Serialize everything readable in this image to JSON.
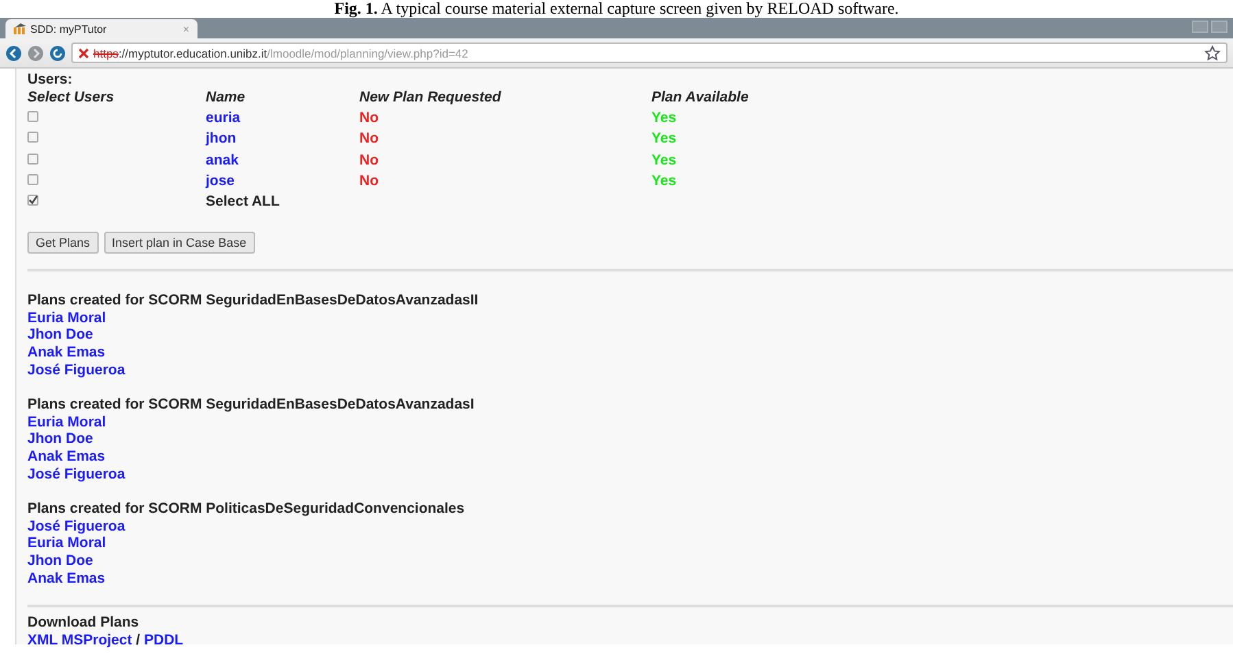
{
  "caption": "**Fig. 1.** A typical course material external capture screen given by RELOAD software.",
  "browser": {
    "tab_title": "SDD: myPTutor",
    "tab_close": "×",
    "certificate_error": true,
    "url_scheme": "https",
    "url_host": "://myptutor.education.unibz.it",
    "url_path": "/lmoodle/mod/planning/view.php?id=42"
  },
  "users": {
    "heading": "Users:",
    "columns": [
      "Select Users",
      "Name",
      "New Plan Requested",
      "Plan Available"
    ],
    "rows": [
      {
        "checked": false,
        "name": "euria",
        "new_plan_requested": "No",
        "plan_available": "Yes"
      },
      {
        "checked": false,
        "name": "jhon",
        "new_plan_requested": "No",
        "plan_available": "Yes"
      },
      {
        "checked": false,
        "name": "anak",
        "new_plan_requested": "No",
        "plan_available": "Yes"
      },
      {
        "checked": false,
        "name": "jose",
        "new_plan_requested": "No",
        "plan_available": "Yes"
      }
    ],
    "select_all": {
      "checked": true,
      "label": "Select ALL"
    }
  },
  "buttons": [
    "Get Plans",
    "Insert plan in Case Base"
  ],
  "plan_sections": [
    {
      "title": "Plans created for SCORM SeguridadEnBasesDeDatosAvanzadasII",
      "users": [
        "Euria Moral",
        "Jhon Doe",
        "Anak Emas",
        "José Figueroa"
      ]
    },
    {
      "title": "Plans created for SCORM SeguridadEnBasesDeDatosAvanzadasI",
      "users": [
        "Euria Moral",
        "Jhon Doe",
        "Anak Emas",
        "José Figueroa"
      ]
    },
    {
      "title": "Plans created for SCORM PoliticasDeSeguridadConvencionales",
      "users": [
        "José Figueroa",
        "Euria Moral",
        "Jhon Doe",
        "Anak Emas"
      ]
    }
  ],
  "download": {
    "title": "Download Plans",
    "links": [
      "XML MSProject",
      "PDDL"
    ],
    "separator": "/"
  }
}
